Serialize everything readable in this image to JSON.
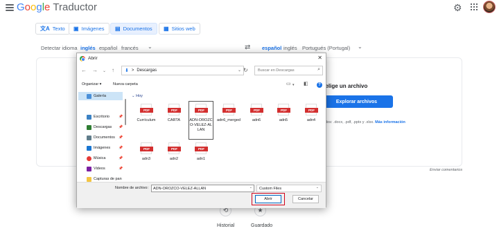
{
  "header": {
    "logo_parts": [
      "G",
      "o",
      "o",
      "g",
      "l",
      "e"
    ],
    "product": "Traductor"
  },
  "mode_tabs": [
    {
      "label": "Texto",
      "icon": "translate-icon"
    },
    {
      "label": "Imágenes",
      "icon": "image-icon"
    },
    {
      "label": "Documentos",
      "icon": "document-icon",
      "active": true
    },
    {
      "label": "Sitios web",
      "icon": "web-icon"
    }
  ],
  "source_langs": [
    "Detectar idioma",
    "inglés",
    "español",
    "francés"
  ],
  "target_langs": [
    "español",
    "inglés",
    "Portugués (Portugal)"
  ],
  "upload": {
    "choose_text": "O elige un archivo",
    "browse_label": "Explorar archivos",
    "types_text": "dos: .docx, .pdf, .pptx y .xlsx.",
    "more_info": "Más información"
  },
  "feedback": "Enviar comentarios",
  "bottom_nav": {
    "history": "Historial",
    "saved": "Guardado"
  },
  "dialog": {
    "title": "Abrir",
    "breadcrumb_sep": ">",
    "path": "Descargas",
    "search_placeholder": "Buscar en Descargas",
    "organize": "Organizar ▾",
    "new_folder": "Nueva carpeta",
    "nav": [
      {
        "label": "Galería",
        "icon": "gallery-icon",
        "color": "#4a90d9",
        "selected": true
      },
      {
        "label": "Escritorio",
        "icon": "desktop-icon",
        "color": "#3b82c4",
        "pinned": true
      },
      {
        "label": "Descargas",
        "icon": "download-icon",
        "color": "#2e7d32",
        "pinned": true
      },
      {
        "label": "Documentos",
        "icon": "document-icon",
        "color": "#607d8b",
        "pinned": true
      },
      {
        "label": "Imágenes",
        "icon": "picture-icon",
        "color": "#1976d2",
        "pinned": true
      },
      {
        "label": "Música",
        "icon": "music-icon",
        "color": "#e53935",
        "pinned": true
      },
      {
        "label": "Videos",
        "icon": "video-icon",
        "color": "#7b1fa2",
        "pinned": true
      },
      {
        "label": "Capturas de pan",
        "icon": "folder-icon",
        "color": "#f4c542"
      }
    ],
    "group_label": "Hoy",
    "files": [
      {
        "name": "Currículum",
        "selected": false
      },
      {
        "name": "CARTA",
        "selected": false
      },
      {
        "name": "ADN-OROZCO-VELEZ-ALLAN",
        "selected": true
      },
      {
        "name": "adn6_merged",
        "selected": false
      },
      {
        "name": "adn6",
        "selected": false
      },
      {
        "name": "adn5",
        "selected": false
      },
      {
        "name": "adn4",
        "selected": false
      },
      {
        "name": "adn3",
        "selected": false
      },
      {
        "name": "adn2",
        "selected": false
      },
      {
        "name": "adn1",
        "selected": false
      }
    ],
    "pdf_badge": "PDF",
    "filename_label": "Nombre de archivo:",
    "filename_value": "ADN-OROZCO-VELEZ-ALLAN",
    "filter_value": "Custom Files",
    "open_label": "Abrir",
    "cancel_label": "Cancelar"
  }
}
